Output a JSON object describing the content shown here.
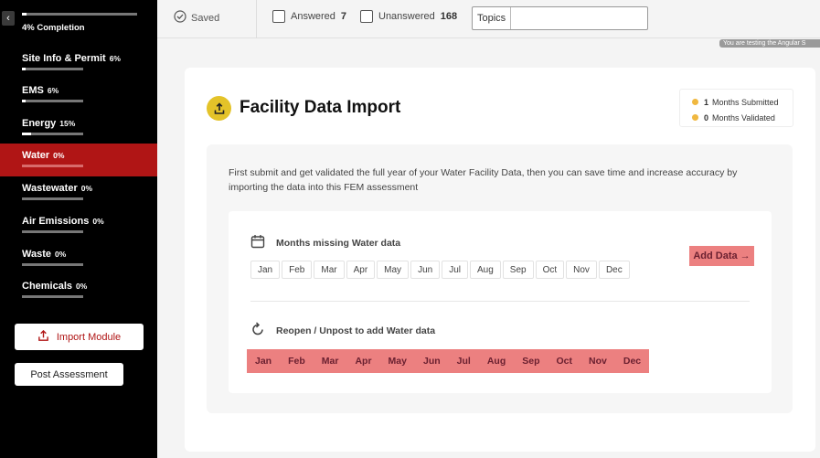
{
  "sidebar": {
    "completion": {
      "label": "4% Completion",
      "progress": 0.04
    },
    "items": [
      {
        "name": "Site Info & Permit",
        "pct": "6%",
        "progress": 0.06
      },
      {
        "name": "EMS",
        "pct": "6%",
        "progress": 0.06
      },
      {
        "name": "Energy",
        "pct": "15%",
        "progress": 0.15
      },
      {
        "name": "Water",
        "pct": "0%",
        "progress": 0.0,
        "active": true
      },
      {
        "name": "Wastewater",
        "pct": "0%",
        "progress": 0.0
      },
      {
        "name": "Air Emissions",
        "pct": "0%",
        "progress": 0.0
      },
      {
        "name": "Waste",
        "pct": "0%",
        "progress": 0.0
      },
      {
        "name": "Chemicals",
        "pct": "0%",
        "progress": 0.0
      }
    ],
    "import_label": "Import Module",
    "post_label": "Post Assessment"
  },
  "topbar": {
    "saved_label": "Saved",
    "answered_label": "Answered",
    "answered_count": "7",
    "unanswered_label": "Unanswered",
    "unanswered_count": "168",
    "topics_label": "Topics",
    "test_badge": "You are testing the Angular S"
  },
  "card": {
    "title": "Facility Data Import",
    "legend": {
      "submitted_count": "1",
      "submitted_label": "Months Submitted",
      "validated_count": "0",
      "validated_label": "Months Validated"
    },
    "intro": "First submit and get validated the full year of your Water Facility Data, then you can save time and increase accuracy by importing the data into this FEM assessment",
    "missing_title": "Months missing Water data",
    "add_data_label": "Add Data →",
    "missing_months": [
      "Jan",
      "Feb",
      "Mar",
      "Apr",
      "May",
      "Jun",
      "Jul",
      "Aug",
      "Sep",
      "Oct",
      "Nov",
      "Dec"
    ],
    "reopen_title": "Reopen / Unpost to add Water data",
    "reopen_months": [
      "Jan",
      "Feb",
      "Mar",
      "Apr",
      "May",
      "Jun",
      "Jul",
      "Aug",
      "Sep",
      "Oct",
      "Nov",
      "Dec"
    ]
  },
  "colors": {
    "sidebar_bg": "#000000",
    "active_item": "#b01515",
    "accent_pink": "#ec8080",
    "title_icon": "#e4c329",
    "legend_dot": "#f0b840"
  }
}
